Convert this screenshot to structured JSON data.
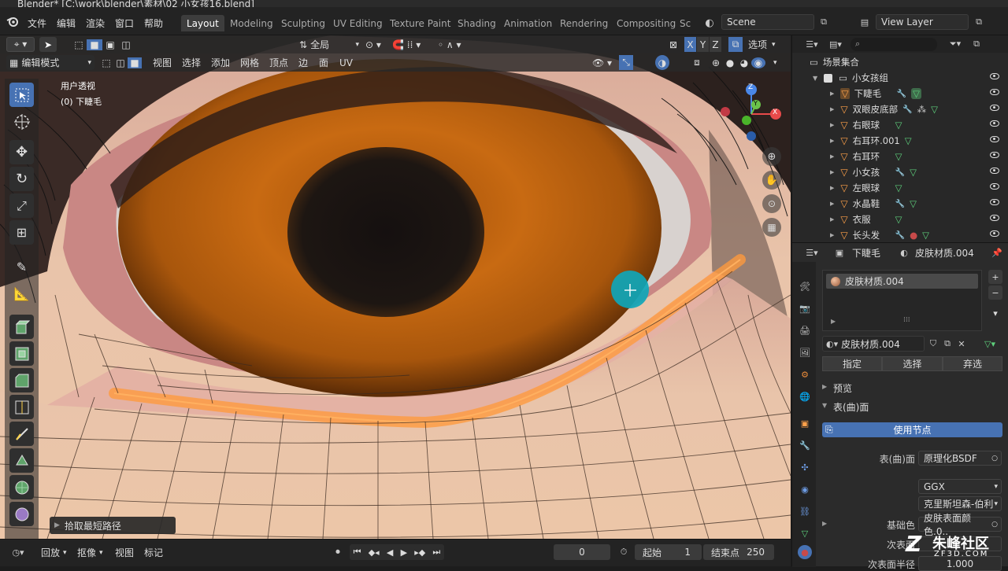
{
  "window": {
    "title": "Blender* [C:\\work\\blender\\素材\\02 小女孩16.blend]"
  },
  "menus": [
    "文件",
    "编辑",
    "渲染",
    "窗口",
    "帮助"
  ],
  "workspaces": [
    "Layout",
    "Modeling",
    "Sculpting",
    "UV Editing",
    "Texture Paint",
    "Shading",
    "Animation",
    "Rendering",
    "Compositing",
    "Sc"
  ],
  "active_workspace": "Layout",
  "scene": {
    "name": "Scene"
  },
  "view_layer": {
    "name": "View Layer"
  },
  "viewport": {
    "transform_orientation": "全局",
    "options_label": "选项",
    "mode": "编辑模式",
    "menus": [
      "视图",
      "选择",
      "添加",
      "网格",
      "顶点",
      "边",
      "面",
      "UV"
    ],
    "view_name": "用户透视",
    "object_info": "(0) 下睫毛",
    "operator_panel": "拾取最短路径",
    "gizmo": {
      "y": "Y",
      "z": "Z",
      "x": "X"
    },
    "axis_buttons": [
      "X",
      "Y",
      "Z"
    ]
  },
  "outliner": {
    "search_placeholder": "",
    "root": "场景集合",
    "collection": "小女孩组",
    "items": [
      {
        "name": "下睫毛",
        "selected": true
      },
      {
        "name": "双眼皮底部"
      },
      {
        "name": "右眼球"
      },
      {
        "name": "右耳环.001"
      },
      {
        "name": "右耳环"
      },
      {
        "name": "小女孩"
      },
      {
        "name": "左眼球"
      },
      {
        "name": "水晶鞋"
      },
      {
        "name": "衣服"
      },
      {
        "name": "长头发"
      }
    ]
  },
  "properties": {
    "object": "下睫毛",
    "material": "皮肤材质.004",
    "slot_name": "皮肤材质.004",
    "material_field": "皮肤材质.004",
    "assign": "指定",
    "select": "选择",
    "deselect": "弃选",
    "preview": "预览",
    "surface": "表(曲)面",
    "use_nodes": "使用节点",
    "surface_label": "表(曲)面",
    "surface_value": "原理化BSDF",
    "distribution": "GGX",
    "subsurface_method": "克里斯坦森-伯利",
    "base_color_label": "基础色",
    "base_color_value": "皮肤表面颜色.0..",
    "subsurface_label": "次表面",
    "subsurface_radius_label": "次表面半径",
    "subsurface_radius_value": "1.000"
  },
  "timeline": {
    "playback": "回放",
    "keying": "抠像",
    "view": "视图",
    "marker": "标记",
    "current_frame": "0",
    "start_label": "起始",
    "start": "1",
    "end_label": "结束点",
    "end": "250"
  },
  "watermark": {
    "text": "朱峰社区",
    "url": "ZF3D.COM"
  },
  "colors": {
    "accent": "#4772b3",
    "selected_edge": "#ff9a3c",
    "object_icon": "#ffa14a",
    "mesh_icon": "#5ed07c",
    "modifier_icon": "#6d9be3"
  }
}
